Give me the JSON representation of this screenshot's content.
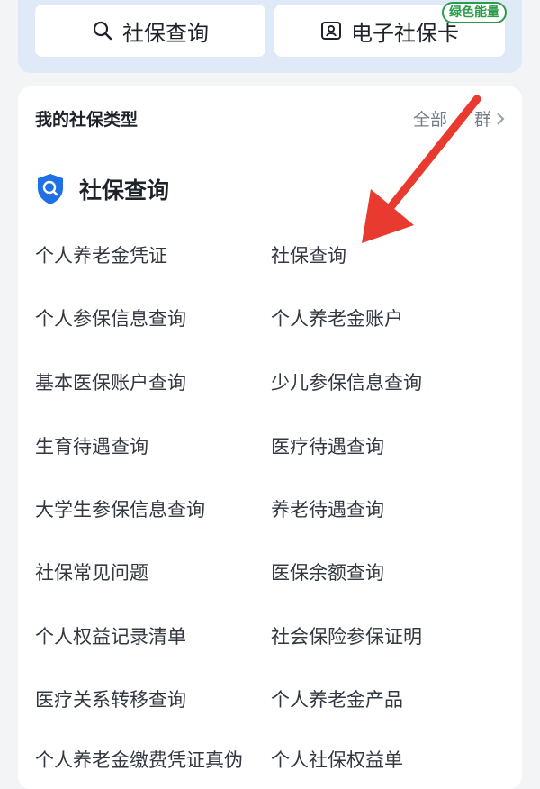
{
  "top_buttons": {
    "query_label": "社保查询",
    "card_label": "电子社保卡",
    "badge": "绿色能量"
  },
  "card": {
    "title": "我的社保类型",
    "more": "全部",
    "more_suffix": "群"
  },
  "section": {
    "title": "社保查询"
  },
  "items_left": [
    "个人养老金凭证",
    "个人参保信息查询",
    "基本医保账户查询",
    "生育待遇查询",
    "大学生参保信息查询",
    "社保常见问题",
    "个人权益记录清单",
    "医疗关系转移查询",
    "个人养老金缴费凭证真伪"
  ],
  "items_right": [
    "社保查询",
    "个人养老金账户",
    "少儿参保信息查询",
    "医疗待遇查询",
    "养老待遇查询",
    "医保余额查询",
    "社会保险参保证明",
    "个人养老金产品",
    "个人社保权益单"
  ],
  "colors": {
    "accent_blue": "#1f6fe5",
    "arrow_red": "#e83a2f",
    "badge_green": "#2a9d4a"
  }
}
